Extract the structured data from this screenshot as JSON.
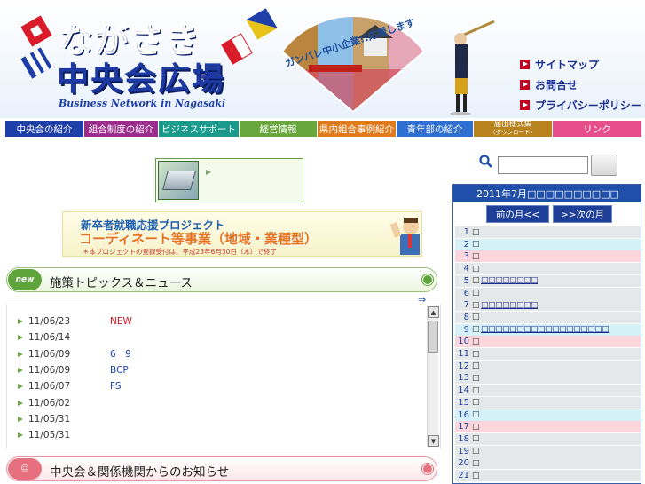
{
  "header": {
    "logo_line1": "ながさき",
    "logo_line2": "中央会広場",
    "logo_tagline": "Business Network in Nagasaki",
    "fan_caption": "ガンバレ中小企業!!応援します",
    "links": [
      {
        "label": "サイトマップ"
      },
      {
        "label": "お問合せ"
      },
      {
        "label": "プライバシーポリシー"
      }
    ]
  },
  "nav": {
    "items": [
      {
        "label": "中央会の紹介",
        "color": "#1f3fa8"
      },
      {
        "label": "組合制度の紹介",
        "color": "#9b2c8c"
      },
      {
        "label": "ビジネスサポート",
        "color": "#1a9a8a"
      },
      {
        "label": "経営情報",
        "color": "#69a73c"
      },
      {
        "label": "県内組合事例紹介",
        "color": "#e07a1a"
      },
      {
        "label": "青年部の紹介",
        "color": "#2f6fd1"
      },
      {
        "label": "届出様式集",
        "sub": "（ダウンロード）",
        "color": "#b8821e"
      },
      {
        "label": "リンク",
        "color": "#e74f8c"
      }
    ]
  },
  "banner2": {
    "line1": "新卒者就職応援プロジェクト",
    "line2": "コーディネート等事業（地域・業種型）",
    "line3": "＊本プロジェクトの登録受付は、平成23年6月30日（木）で終了"
  },
  "topics": {
    "badge": "new",
    "title": "施策トピックス＆ニュース",
    "more_icon": "double-arrow-icon",
    "items": [
      {
        "date": "11/06/23",
        "title": "NEW",
        "red": true
      },
      {
        "date": "11/06/14",
        "title": ""
      },
      {
        "date": "11/06/09",
        "title": "6　9"
      },
      {
        "date": "11/06/09",
        "title": "BCP"
      },
      {
        "date": "11/06/07",
        "title": "FS"
      },
      {
        "date": "11/06/02",
        "title": ""
      },
      {
        "date": "11/05/31",
        "title": ""
      },
      {
        "date": "11/05/31",
        "title": ""
      }
    ]
  },
  "notices": {
    "title": "中央会＆関係機関からのお知らせ"
  },
  "search": {
    "placeholder": "",
    "button_label": ""
  },
  "calendar": {
    "title": "2011年7月□□□□□□□□□□",
    "prev_label": "前の月<<",
    "next_label": ">>次の月",
    "days": [
      {
        "d": "1",
        "w": "□",
        "ev": "",
        "c": "gray"
      },
      {
        "d": "2",
        "w": "□",
        "ev": "",
        "c": "blue"
      },
      {
        "d": "3",
        "w": "□",
        "ev": "",
        "c": "pink"
      },
      {
        "d": "4",
        "w": "□",
        "ev": "",
        "c": "gray"
      },
      {
        "d": "5",
        "w": "□",
        "ev": "□□□□□□□□",
        "c": "gray"
      },
      {
        "d": "6",
        "w": "□",
        "ev": "",
        "c": "gray"
      },
      {
        "d": "7",
        "w": "□",
        "ev": "□□□□□□□□",
        "c": "gray"
      },
      {
        "d": "8",
        "w": "□",
        "ev": "",
        "c": "gray"
      },
      {
        "d": "9",
        "w": "□",
        "ev": "□□□□□□□□□□□□□□□□□□",
        "c": "blue"
      },
      {
        "d": "10",
        "w": "□",
        "ev": "",
        "c": "pink"
      },
      {
        "d": "11",
        "w": "□",
        "ev": "",
        "c": "gray"
      },
      {
        "d": "12",
        "w": "□",
        "ev": "",
        "c": "gray"
      },
      {
        "d": "13",
        "w": "□",
        "ev": "",
        "c": "gray"
      },
      {
        "d": "14",
        "w": "□",
        "ev": "",
        "c": "gray"
      },
      {
        "d": "15",
        "w": "□",
        "ev": "",
        "c": "gray"
      },
      {
        "d": "16",
        "w": "□",
        "ev": "",
        "c": "blue"
      },
      {
        "d": "17",
        "w": "□",
        "ev": "",
        "c": "pink"
      },
      {
        "d": "18",
        "w": "□",
        "ev": "",
        "c": "gray"
      },
      {
        "d": "19",
        "w": "□",
        "ev": "",
        "c": "gray"
      },
      {
        "d": "20",
        "w": "□",
        "ev": "",
        "c": "gray"
      },
      {
        "d": "21",
        "w": "□",
        "ev": "",
        "c": "gray"
      }
    ]
  }
}
